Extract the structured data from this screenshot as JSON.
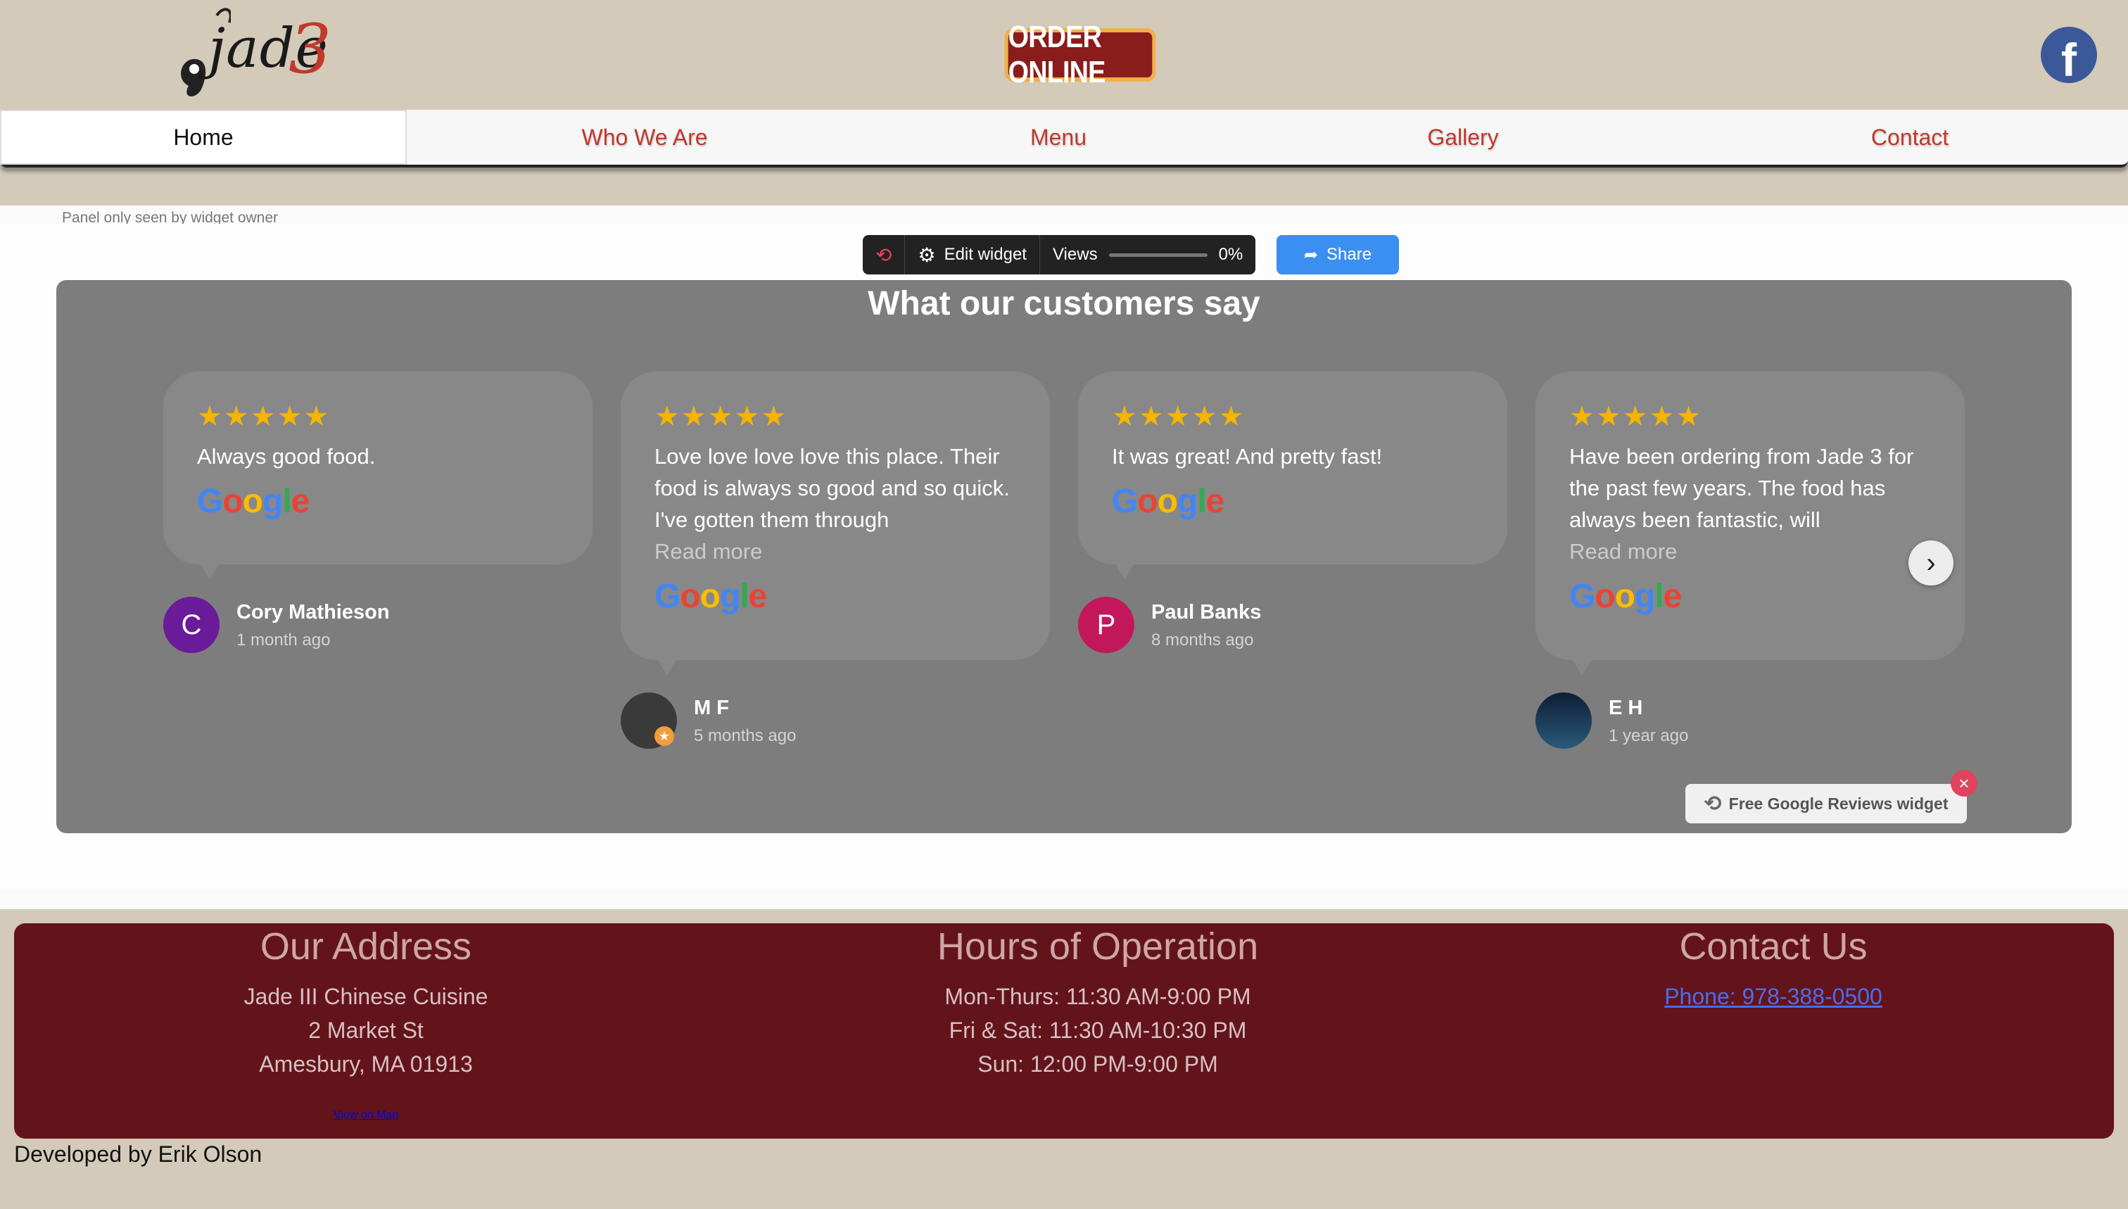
{
  "header": {
    "logo_text": "jade",
    "logo_number": "3",
    "order_button": "ORDER ONLINE",
    "facebook_glyph": "f"
  },
  "nav": {
    "items": [
      {
        "label": "Home",
        "active": true
      },
      {
        "label": "Who We Are",
        "active": false
      },
      {
        "label": "Menu",
        "active": false
      },
      {
        "label": "Gallery",
        "active": false
      },
      {
        "label": "Contact",
        "active": false
      }
    ]
  },
  "widget_panel": {
    "note": "Panel only seen by widget owner",
    "edit_label": "Edit widget",
    "views_label": "Views",
    "views_percent": "0%",
    "share_label": "Share"
  },
  "reviews": {
    "title": "What our customers say",
    "items": [
      {
        "stars": "★★★★★",
        "text": "Always good food.",
        "read_more": "",
        "name": "Cory Mathieson",
        "time": "1 month ago",
        "initial": "C",
        "avatar_color": "#6a1b9a"
      },
      {
        "stars": "★★★★★",
        "text": "Love love love love this place. Their food is always so good and so quick. I've gotten them through",
        "read_more": "Read more",
        "name": "M F",
        "time": "5 months ago",
        "initial": "",
        "avatar_color": "#3a3a3a"
      },
      {
        "stars": "★★★★★",
        "text": "It was great! And pretty fast!",
        "read_more": "",
        "name": "Paul Banks",
        "time": "8 months ago",
        "initial": "P",
        "avatar_color": "#c2185b"
      },
      {
        "stars": "★★★★★",
        "text": "Have been ordering from Jade 3 for the past few years. The food has always been fantastic, will",
        "read_more": "Read more",
        "name": "E H",
        "time": "1 year ago",
        "initial": "",
        "avatar_color": "#1b3a5c"
      }
    ],
    "google_logo": "Google",
    "free_badge": "Free Google Reviews widget",
    "next_arrow": "›",
    "close_glyph": "×"
  },
  "footer": {
    "address": {
      "heading": "Our Address",
      "lines": [
        "Jade III Chinese Cuisine",
        "2 Market St",
        "Amesbury, MA 01913"
      ],
      "map_link": "View on Map"
    },
    "hours": {
      "heading": "Hours of Operation",
      "lines": [
        "Mon-Thurs: 11:30 AM-9:00 PM",
        "Fri & Sat: 11:30 AM-10:30 PM",
        "Sun: 12:00 PM-9:00 PM"
      ]
    },
    "contact": {
      "heading": "Contact Us",
      "phone_link": "Phone: 978-388-0500"
    },
    "developer": "Developed by Erik Olson"
  }
}
